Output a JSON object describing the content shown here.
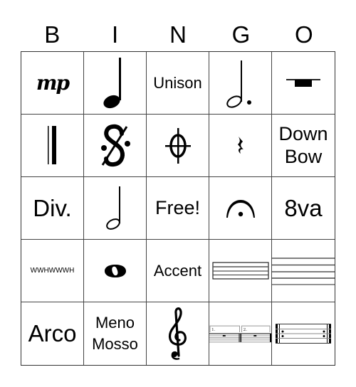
{
  "header": {
    "letters": [
      "B",
      "I",
      "N",
      "G",
      "O"
    ]
  },
  "cells": [
    {
      "label": "mp",
      "kind": "symbol",
      "icon": "mezzo-piano-icon"
    },
    {
      "label": "",
      "kind": "symbol",
      "icon": "quarter-note-icon"
    },
    {
      "label": "Unison",
      "kind": "text"
    },
    {
      "label": "",
      "kind": "symbol",
      "icon": "dotted-half-note-icon"
    },
    {
      "label": "",
      "kind": "symbol",
      "icon": "half-rest-icon"
    },
    {
      "label": "",
      "kind": "symbol",
      "icon": "final-barline-icon"
    },
    {
      "label": "",
      "kind": "symbol",
      "icon": "segno-icon"
    },
    {
      "label": "",
      "kind": "symbol",
      "icon": "coda-icon"
    },
    {
      "label": "",
      "kind": "symbol",
      "icon": "quarter-rest-icon"
    },
    {
      "label": "Down Bow",
      "kind": "text"
    },
    {
      "label": "Div.",
      "kind": "text"
    },
    {
      "label": "",
      "kind": "symbol",
      "icon": "half-note-icon"
    },
    {
      "label": "Free!",
      "kind": "text"
    },
    {
      "label": "",
      "kind": "symbol",
      "icon": "fermata-icon"
    },
    {
      "label": "8va",
      "kind": "text"
    },
    {
      "label": "WWHWWWH",
      "kind": "text"
    },
    {
      "label": "",
      "kind": "symbol",
      "icon": "whole-note-icon"
    },
    {
      "label": "Accent",
      "kind": "text"
    },
    {
      "label": "",
      "kind": "symbol",
      "icon": "staff-small-icon"
    },
    {
      "label": "",
      "kind": "symbol",
      "icon": "staff-lines-icon"
    },
    {
      "label": "Arco",
      "kind": "text"
    },
    {
      "label": "Meno Mosso",
      "kind": "text"
    },
    {
      "label": "",
      "kind": "symbol",
      "icon": "treble-clef-icon"
    },
    {
      "label": "",
      "kind": "symbol",
      "icon": "first-second-ending-icon",
      "ending_labels": [
        "1.",
        "2."
      ]
    },
    {
      "label": "",
      "kind": "symbol",
      "icon": "repeat-signs-icon"
    }
  ]
}
